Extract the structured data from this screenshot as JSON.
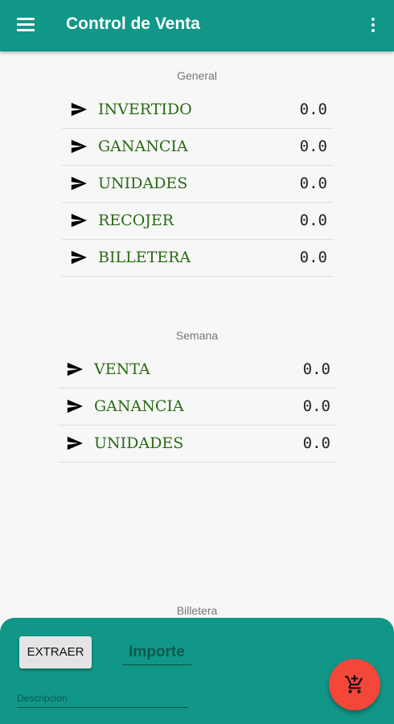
{
  "appbar": {
    "title": "Control de Venta",
    "menu_icon": "menu-icon",
    "overflow_icon": "more-vert-icon",
    "color": "#119787"
  },
  "general": {
    "label": "General",
    "rows": [
      {
        "label": "INVERTIDO",
        "value": "0.0"
      },
      {
        "label": "GANANCIA",
        "value": "0.0"
      },
      {
        "label": "UNIDADES",
        "value": "0.0"
      },
      {
        "label": "RECOJER",
        "value": "0.0"
      },
      {
        "label": "BILLETERA",
        "value": "0.0"
      }
    ]
  },
  "semana": {
    "label": "Semana",
    "rows": [
      {
        "label": "VENTA",
        "value": "0.0"
      },
      {
        "label": "GANANCIA",
        "value": "0.0"
      },
      {
        "label": "UNIDADES",
        "value": "0.0"
      }
    ]
  },
  "billetera": {
    "label": "Billetera",
    "extract_label": "EXTRAER",
    "importe_placeholder": "Importe",
    "descripcion_placeholder": "Descripcion",
    "fab_icon": "add-shopping-cart-icon",
    "fab_color": "#f4473a"
  },
  "row_icon": "send-icon"
}
